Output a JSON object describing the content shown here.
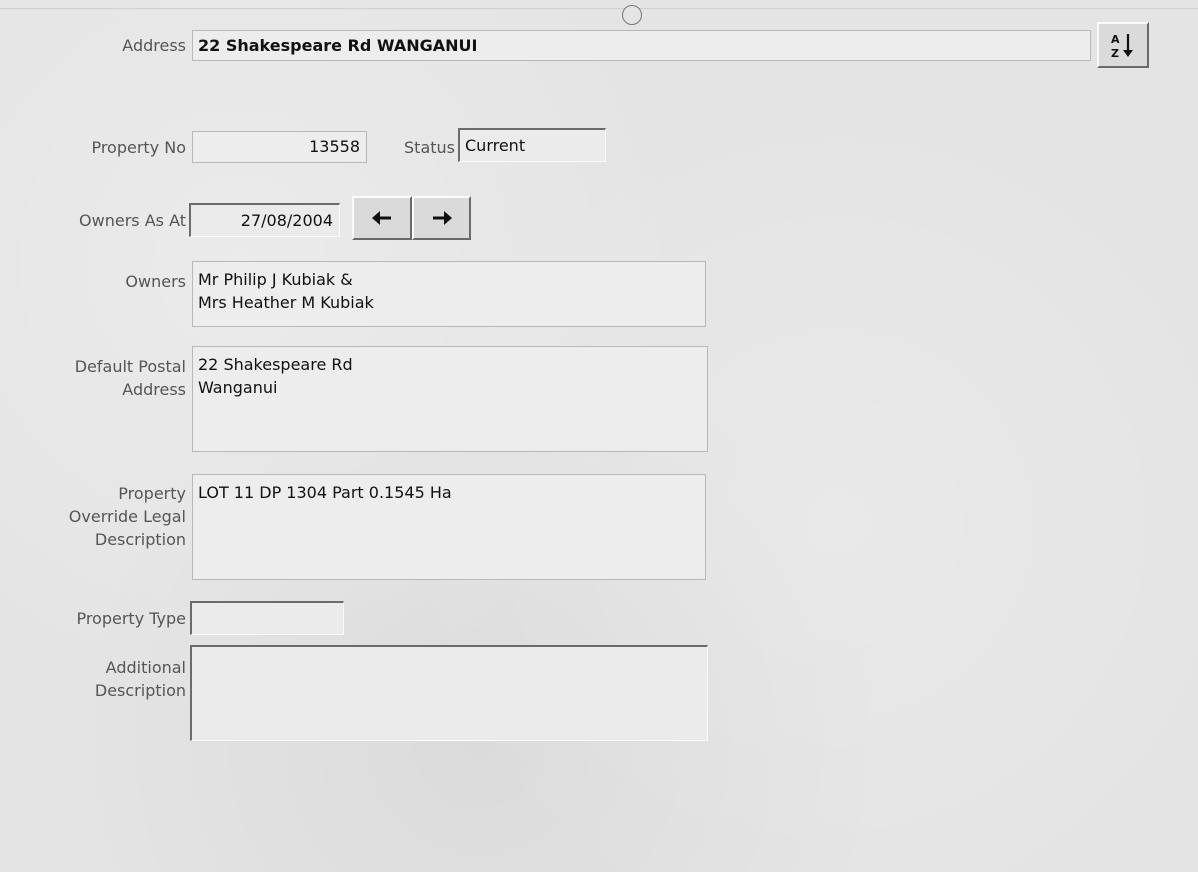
{
  "address": {
    "label": "Address",
    "value": "22 Shakespeare Rd WANGANUI",
    "sort_icon": "sort-az-icon"
  },
  "property_no": {
    "label": "Property No",
    "value": "13558"
  },
  "status": {
    "label": "Status",
    "value": "Current"
  },
  "owners_as_at": {
    "label": "Owners As At",
    "value": "27/08/2004",
    "prev_icon": "arrow-left-icon",
    "next_icon": "arrow-right-icon"
  },
  "owners": {
    "label": "Owners",
    "value": "Mr Philip J Kubiak &\nMrs Heather M Kubiak"
  },
  "postal_address": {
    "label_line1": "Default Postal",
    "label_line2": "Address",
    "value": "22 Shakespeare Rd\nWanganui"
  },
  "legal_description": {
    "label_line1": "Property",
    "label_line2": "Override Legal",
    "label_line3": "Description",
    "value": "LOT 11 DP 1304 Part 0.1545 Ha"
  },
  "property_type": {
    "label": "Property Type",
    "value": ""
  },
  "additional_description": {
    "label_line1": "Additional",
    "label_line2": "Description",
    "value": ""
  }
}
